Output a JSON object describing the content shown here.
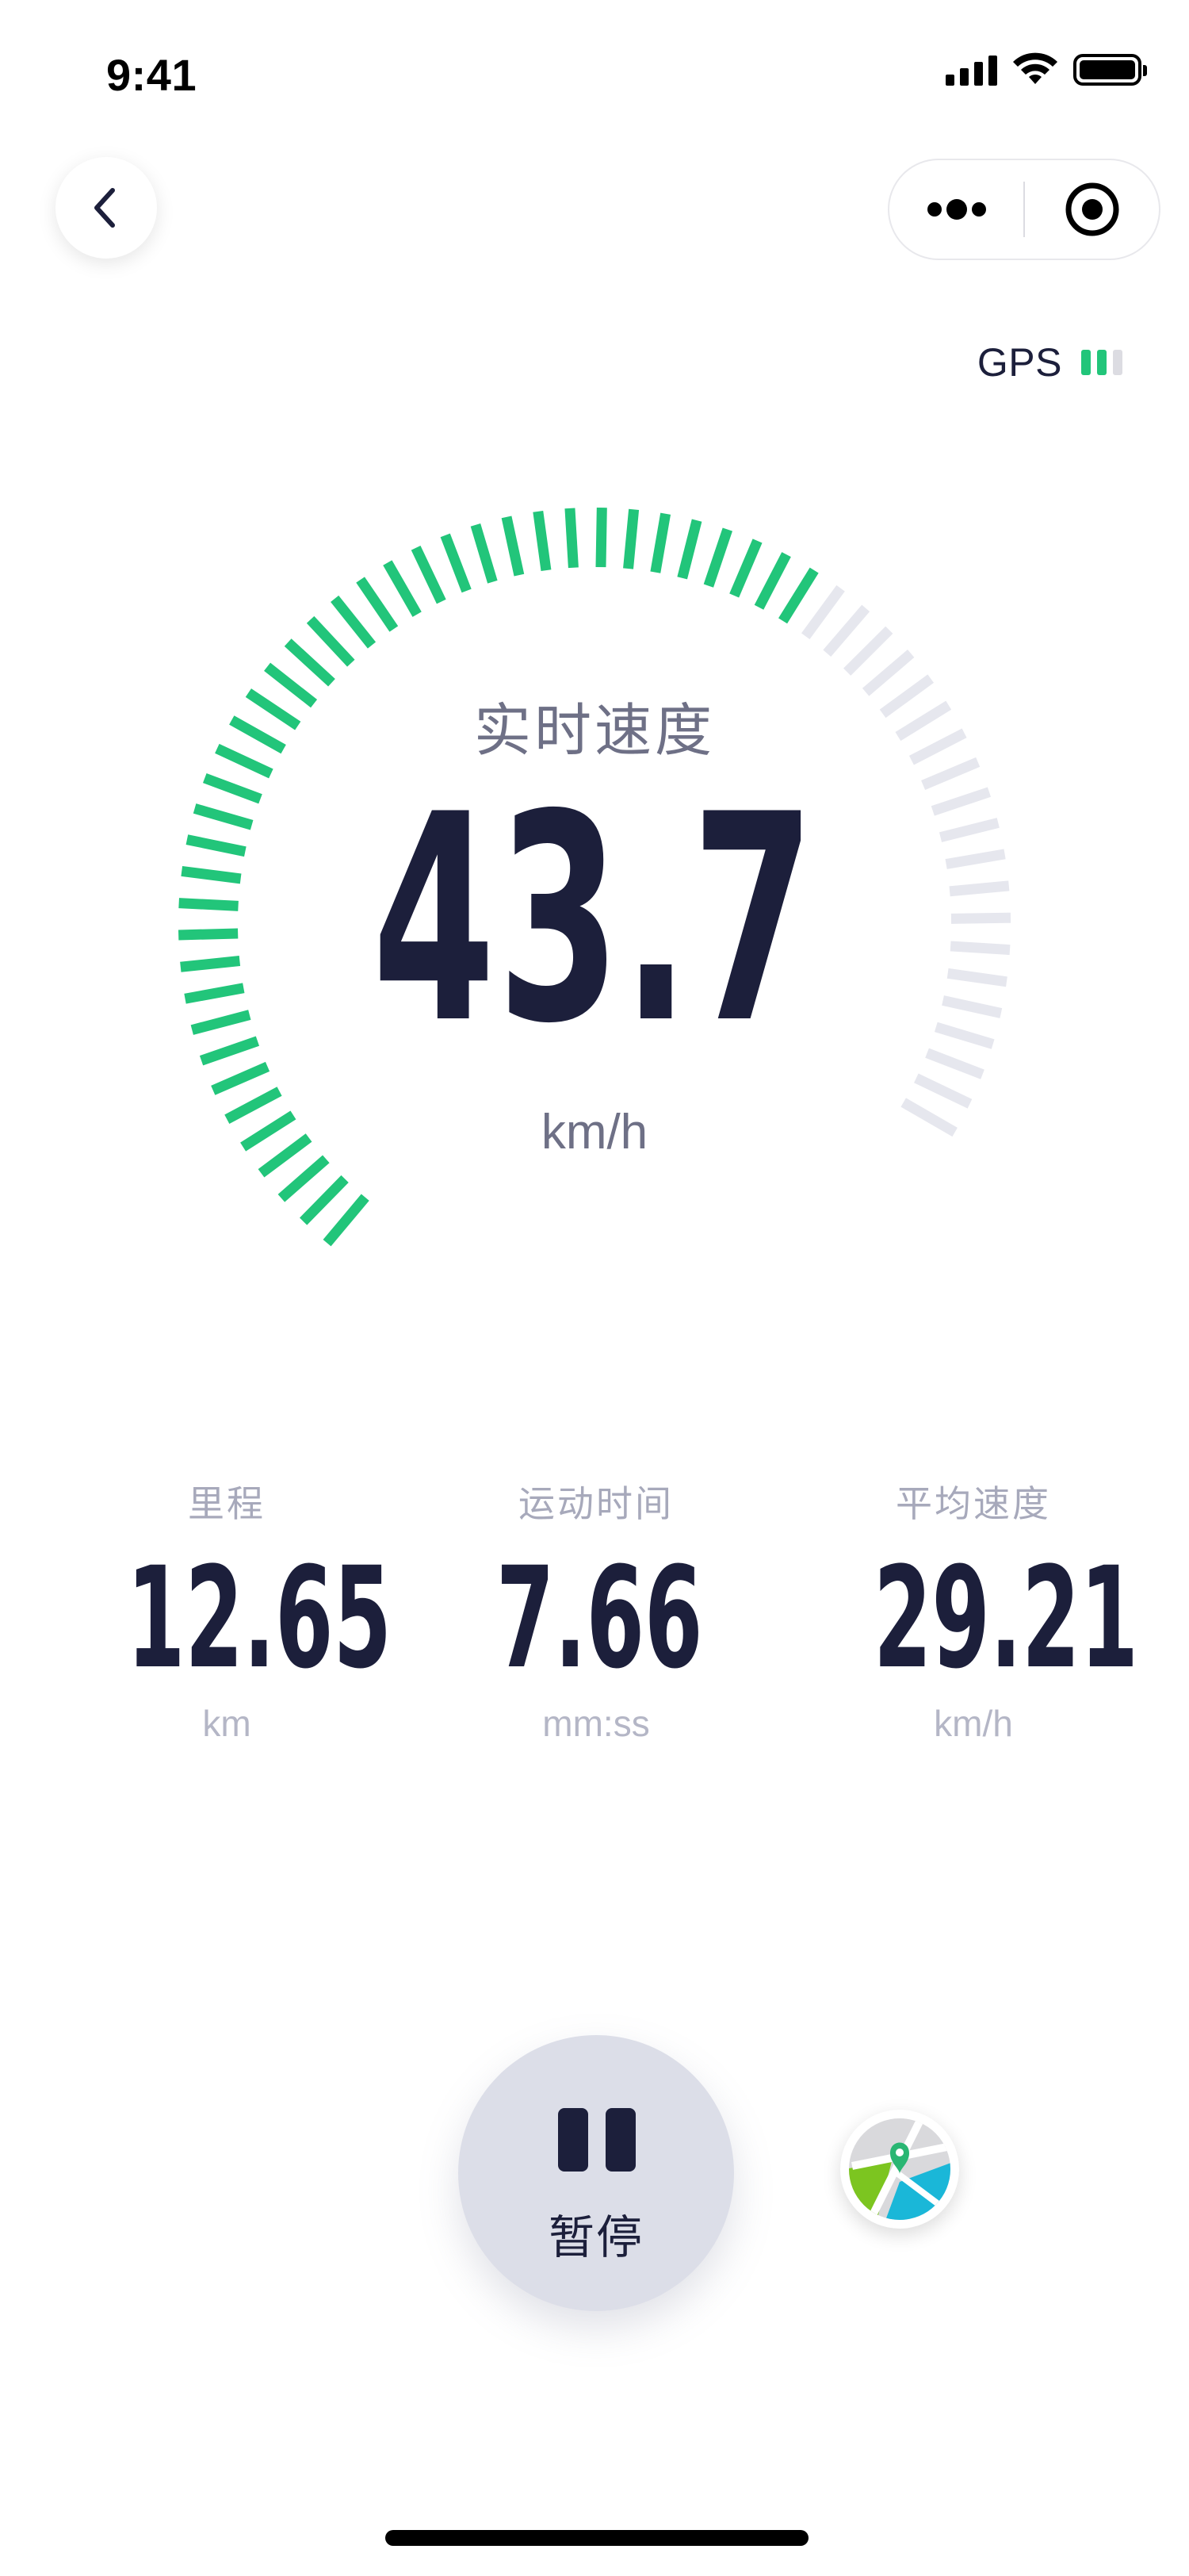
{
  "status_bar": {
    "time": "9:41"
  },
  "gps": {
    "label": "GPS",
    "bars_active": 2,
    "bars_total": 3,
    "active_color": "#22c57a",
    "inactive_color": "#dcdce2"
  },
  "speed": {
    "title": "实时速度",
    "value": "43.7",
    "unit": "km/h",
    "gauge_fill_fraction": 0.67,
    "active_color": "#22c57a",
    "inactive_color": "#e6e7ee"
  },
  "stats": [
    {
      "label": "里程",
      "value": "12.65",
      "unit": "km"
    },
    {
      "label": "运动时间",
      "value": "7.66",
      "unit": "mm:ss"
    },
    {
      "label": "平均速度",
      "value": "29.21",
      "unit": "km/h"
    }
  ],
  "controls": {
    "pause_label": "暂停"
  },
  "icons": {
    "back": "chevron-left-icon",
    "more": "more-dots-icon",
    "miniapp_close": "target-circle-icon",
    "pause": "pause-icon",
    "map": "map-icon"
  }
}
